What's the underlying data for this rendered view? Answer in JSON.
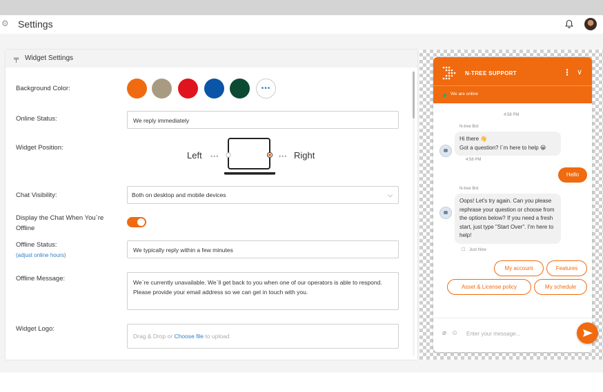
{
  "header": {
    "title": "Settings"
  },
  "card": {
    "title": "Widget Settings",
    "labels": {
      "background_color": "Background Color:",
      "online_status": "Online Status:",
      "widget_position": "Widget Position:",
      "chat_visibility": "Chat Visibility:",
      "display_offline": "Display the Chat When You`re Offline",
      "offline_status": "Offline Status:",
      "adjust_link": "adjust online hours",
      "offline_message": "Offline Message:",
      "widget_logo": "Widget Logo:"
    },
    "swatches": [
      "#f06a0f",
      "#a99a82",
      "#e0141e",
      "#0b55a8",
      "#0d4a33"
    ],
    "more_label": "•••",
    "online_status_value": "We reply immediately",
    "position": {
      "left": "Left",
      "right": "Right",
      "selected": "Right"
    },
    "chat_visibility_value": "Both on desktop and mobile devices",
    "offline_toggle_on": true,
    "offline_status_value": "We typically reply within a few minutes",
    "offline_message_value": "We`re currently unavailable. We`ll get back to you when one of our operators is able to respond. Please provide your email address so we can get in touch with you.",
    "dropzone": {
      "prefix": "Drag & Drop or",
      "link": "Choose file",
      "suffix": "to upload"
    }
  },
  "chat": {
    "title": "N-TREE SUPPORT",
    "status": "We are online",
    "accent": "#f06a0f",
    "time_top": "4:58 PM",
    "bot_name_1": "N-tree Bot",
    "msg1": "Hi there 👋\nGot a question? I`m here to help 😀",
    "time_msg1": "4:58 PM",
    "user_msg": "Hello",
    "bot_name_2": "N-tree Bot",
    "msg2": "Oops! Let's try again. Can you please rephrase your question or choose from the options below? If you need a fresh start, just type \"Start Over\". I'm here to help!",
    "time_msg2": "Just Now",
    "options": [
      "My account",
      "Features",
      "Asset & License policy",
      "My schedule"
    ],
    "input_placeholder": "Enter your message..."
  }
}
